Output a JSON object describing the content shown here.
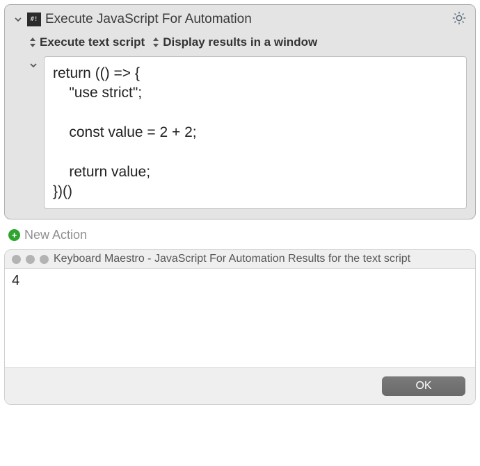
{
  "action": {
    "title": "Execute JavaScript For Automation",
    "icon_glyph": "#!",
    "options": {
      "script_source": "Execute text script",
      "result_target": "Display results in a window"
    },
    "script": "return (() => {\n    \"use strict\";\n\n    const value = 2 + 2;\n\n    return value;\n})()"
  },
  "new_action_label": "New Action",
  "result_window": {
    "title": "Keyboard Maestro - JavaScript For Automation Results for the text script",
    "output": "4",
    "ok_label": "OK"
  }
}
